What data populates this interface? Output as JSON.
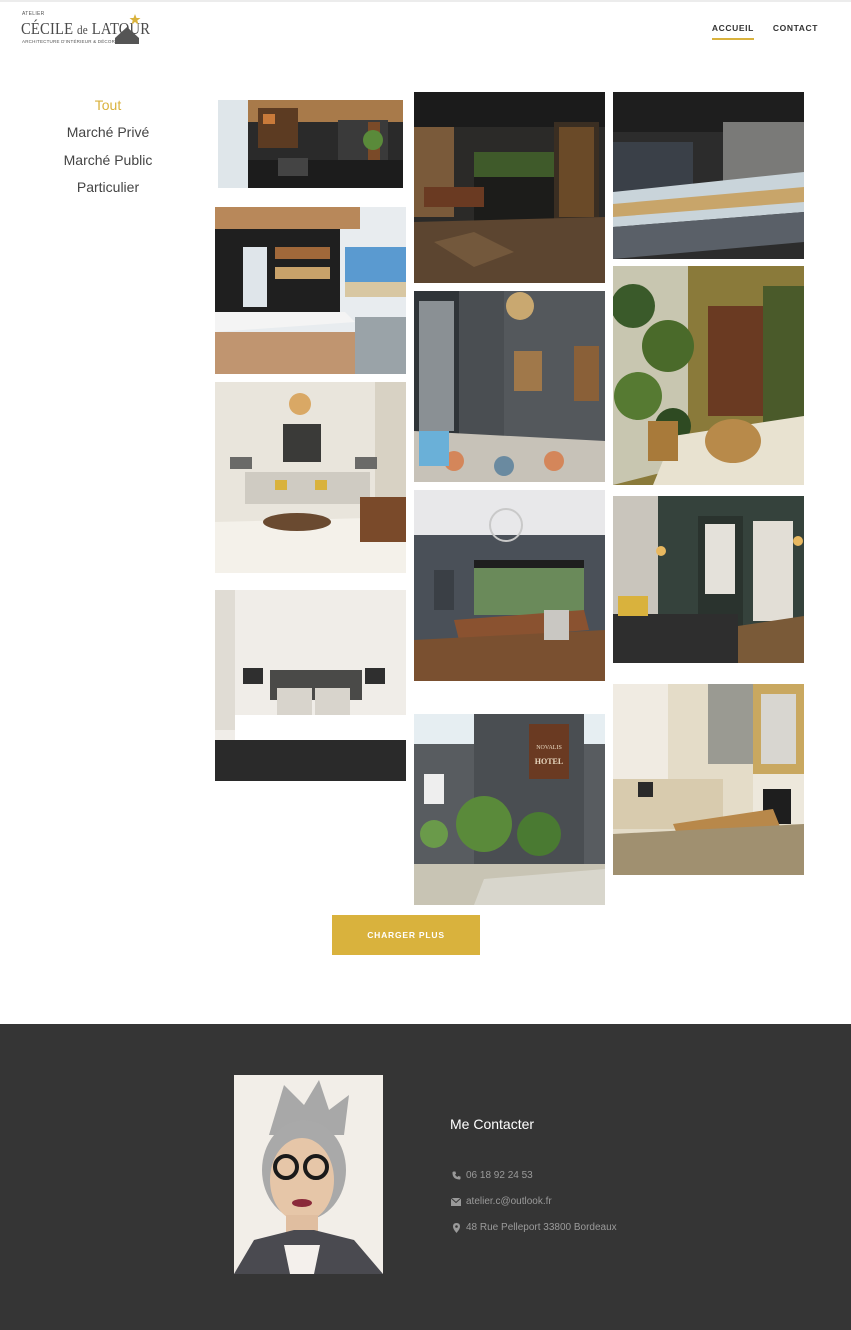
{
  "logo": {
    "atelier": "ATELIER",
    "name_first": "CÉCILE",
    "name_de": "de",
    "name_last": "LATOUR",
    "tagline": "ARCHITECTURE D'INTÉRIEUR & DÉCORATION"
  },
  "nav": [
    {
      "label": "ACCUEIL",
      "active": true
    },
    {
      "label": "CONTACT",
      "active": false
    }
  ],
  "filters": [
    {
      "label": "Tout",
      "active": true
    },
    {
      "label": "Marché Privé",
      "active": false
    },
    {
      "label": "Marché Public",
      "active": false
    },
    {
      "label": "Particulier",
      "active": false
    }
  ],
  "gallery": {
    "items": [
      {
        "name": "lounge-restaurant",
        "subject": "restaurant lounge"
      },
      {
        "name": "wine-bar",
        "subject": "wine bar"
      },
      {
        "name": "bakery-counter",
        "subject": "bakery counter"
      },
      {
        "name": "coffee-corner",
        "subject": "coffee corner"
      },
      {
        "name": "grey-hallway",
        "subject": "grey hallway"
      },
      {
        "name": "jungle-entrance",
        "subject": "jungle wallpaper entrance"
      },
      {
        "name": "living-room",
        "subject": "living room"
      },
      {
        "name": "bistro-dining",
        "subject": "bistro dining room"
      },
      {
        "name": "hotel-room-green",
        "subject": "hotel room"
      },
      {
        "name": "hotel-bedroom",
        "subject": "hotel bedroom"
      },
      {
        "name": "novalis-hotel",
        "subject": "hotel facade",
        "sign_top": "NOVALIS",
        "sign_bottom": "HOTEL"
      },
      {
        "name": "classic-salon",
        "subject": "classic salon"
      }
    ],
    "load_more_label": "CHARGER PLUS"
  },
  "footer": {
    "contact_title": "Me Contacter",
    "phone": "06 18 92 24 53",
    "email": "atelier.c@outlook.fr",
    "address": "48 Rue Pelleport 33800 Bordeaux",
    "icons": {
      "phone": "phone-icon",
      "email": "envelope-icon",
      "address": "map-marker-icon"
    }
  },
  "colors": {
    "accent": "#d9b23d",
    "footer_bg": "#353535",
    "text": "#444444"
  }
}
